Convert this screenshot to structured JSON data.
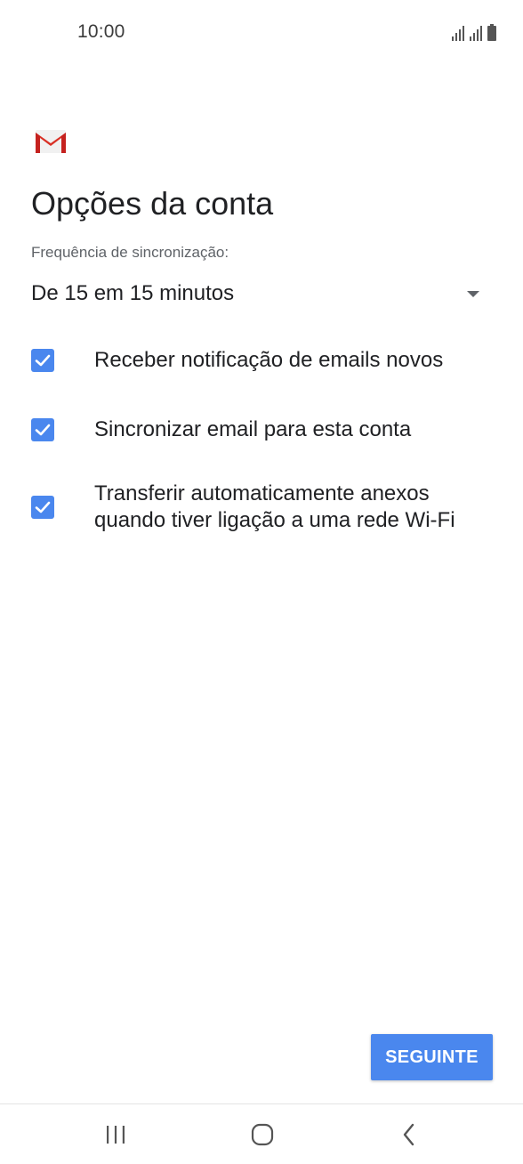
{
  "status_bar": {
    "time": "10:00"
  },
  "app": {
    "logo": "gmail-logo",
    "title": "Opções da conta"
  },
  "sync": {
    "label": "Frequência de sincronização:",
    "value": "De 15 em 15 minutos"
  },
  "options": [
    {
      "label": "Receber notificação de emails novos",
      "checked": true
    },
    {
      "label": "Sincronizar email para esta conta",
      "checked": true
    },
    {
      "label_line1": "Transferir automaticamente anexos",
      "label_line2": "quando tiver ligação a uma rede Wi-Fi",
      "checked": true
    }
  ],
  "next_button": {
    "label": "SEGUINTE"
  },
  "nav": {
    "recents": "recents-icon",
    "home": "home-icon",
    "back": "back-icon"
  },
  "colors": {
    "accent": "#4a87ee",
    "gmail_red": "#d93025"
  }
}
